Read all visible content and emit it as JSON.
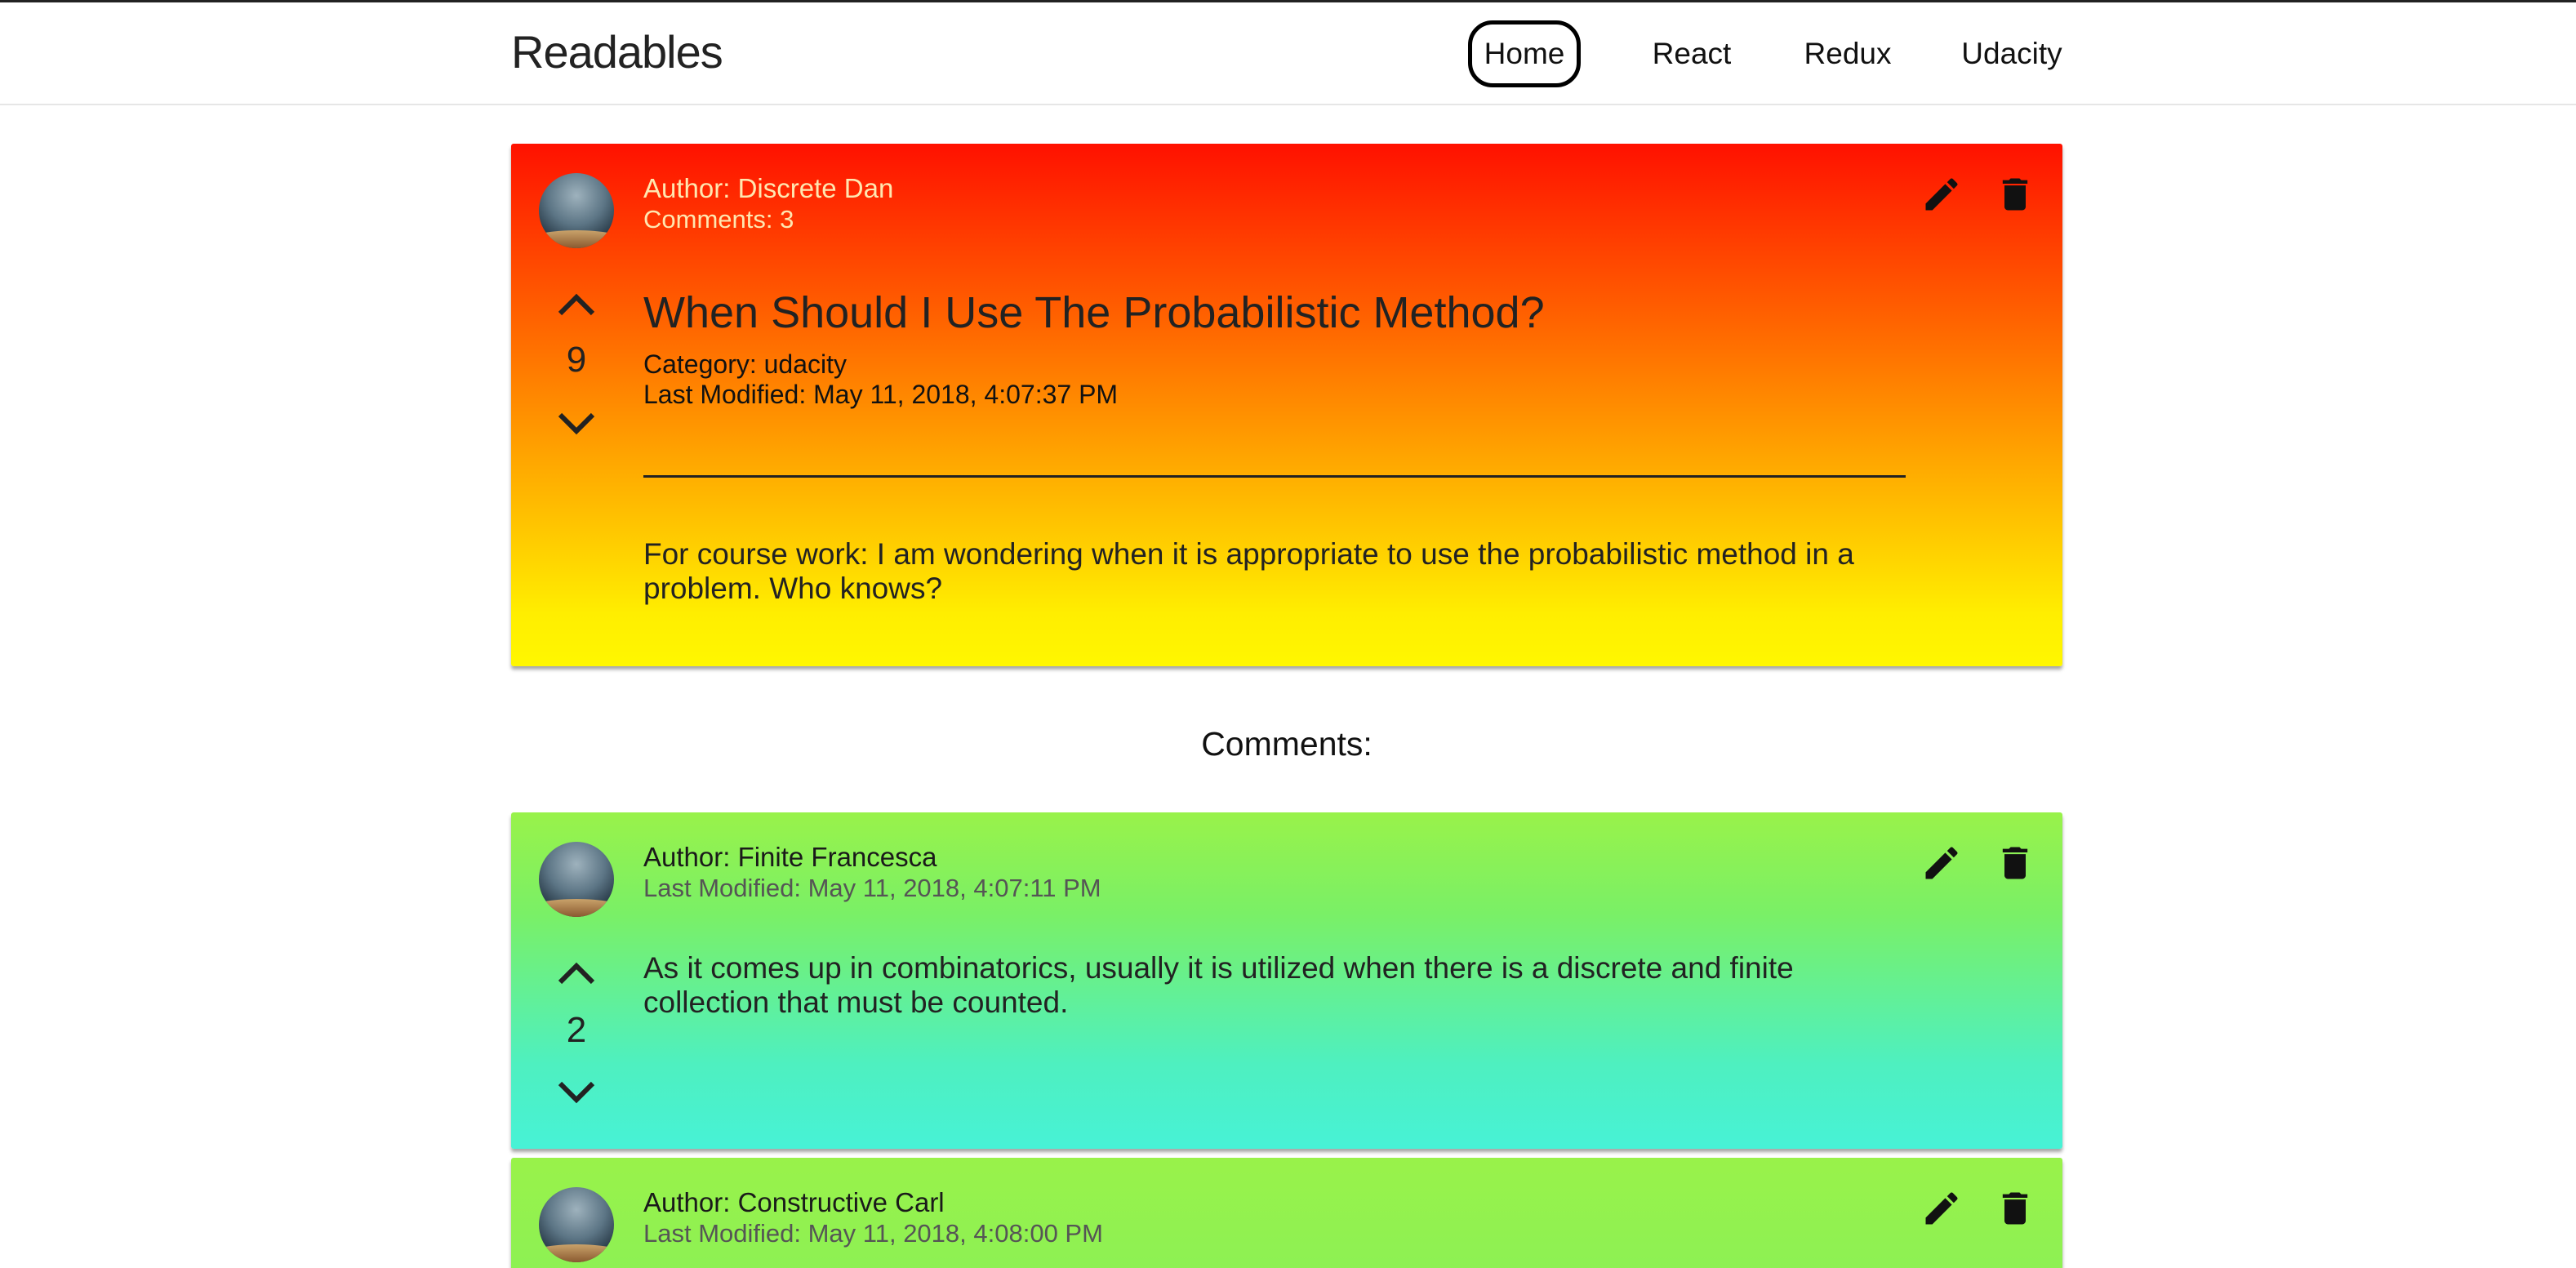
{
  "app": {
    "title": "Readables"
  },
  "nav": {
    "items": [
      "Home",
      "React",
      "Redux",
      "Udacity"
    ],
    "active": "Home"
  },
  "post": {
    "author_label": "Author: Discrete Dan",
    "comments_label": "Comments: 3",
    "title": "When Should I Use The Probabilistic Method?",
    "category_label": "Category: udacity",
    "last_modified_label": "Last Modified: May 11, 2018, 4:07:37 PM",
    "score": "9",
    "body": "For course work: I am wondering when it is appropriate to use the probabilistic method in a problem. Who knows?",
    "gradient_colors": [
      "#ff1100",
      "#fff700"
    ]
  },
  "comments_heading": "Comments:",
  "comments": [
    {
      "author_label": "Author: Finite Francesca",
      "last_modified_label": "Last Modified: May 11, 2018, 4:07:11 PM",
      "score": "2",
      "body": "As it comes up in combinatorics, usually it is utilized when there is a discrete and finite collection that must be counted."
    },
    {
      "author_label": "Author: Constructive Carl",
      "last_modified_label": "Last Modified: May 11, 2018, 4:08:00 PM"
    }
  ],
  "comment_gradient_colors": [
    "#99f24a",
    "#47f2d6"
  ],
  "icons": [
    "edit-icon",
    "delete-icon",
    "chevron-up-icon",
    "chevron-down-icon",
    "avatar"
  ]
}
